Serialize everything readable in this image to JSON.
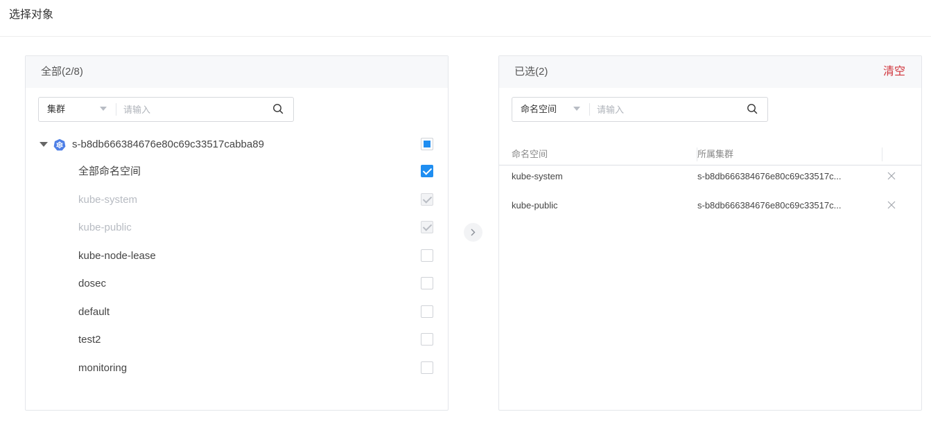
{
  "header": {
    "title": "选择对象"
  },
  "left_panel": {
    "title": "全部(2/8)",
    "search": {
      "select_value": "集群",
      "placeholder": "请输入"
    },
    "tree": {
      "root_label": "s-b8db666384676e80c69c33517cabba89",
      "root_checkbox": "indeterminate",
      "items": [
        {
          "label": "全部命名空间",
          "state": "checked"
        },
        {
          "label": "kube-system",
          "state": "disabled-checked"
        },
        {
          "label": "kube-public",
          "state": "disabled-checked"
        },
        {
          "label": "kube-node-lease",
          "state": "unchecked"
        },
        {
          "label": "dosec",
          "state": "unchecked"
        },
        {
          "label": "default",
          "state": "unchecked"
        },
        {
          "label": "test2",
          "state": "unchecked"
        },
        {
          "label": "monitoring",
          "state": "unchecked"
        }
      ]
    }
  },
  "transfer_button": {
    "icon": "chevron-right-icon"
  },
  "right_panel": {
    "title": "已选(2)",
    "clear_label": "清空",
    "search": {
      "select_value": "命名空间",
      "placeholder": "请输入"
    },
    "table": {
      "columns": [
        "命名空间",
        "所属集群"
      ],
      "rows": [
        {
          "namespace": "kube-system",
          "cluster": "s-b8db666384676e80c69c33517c..."
        },
        {
          "namespace": "kube-public",
          "cluster": "s-b8db666384676e80c69c33517c..."
        }
      ]
    }
  },
  "colors": {
    "accent": "#1f8ef1",
    "danger": "#d0333b",
    "panel_header_bg": "#f7f8fa"
  }
}
